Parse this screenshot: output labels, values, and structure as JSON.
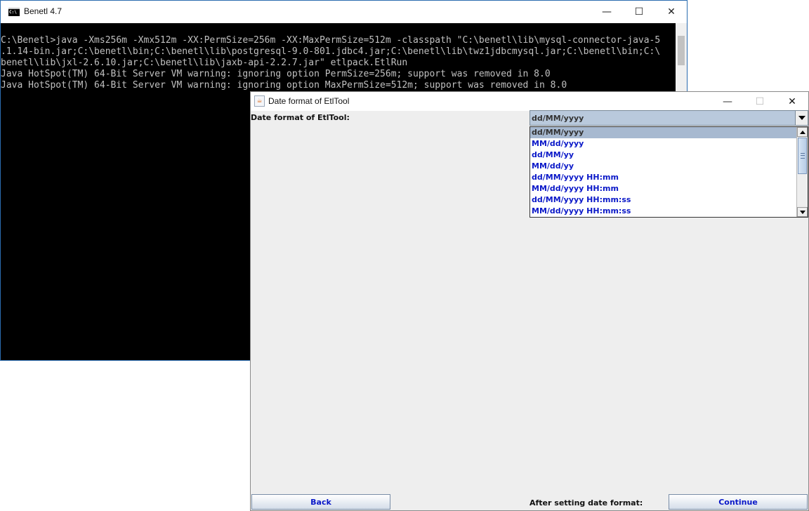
{
  "console": {
    "title": "Benetl 4.7",
    "lines": [
      "C:\\Benetl>java -Xms256m -Xmx512m -XX:PermSize=256m -XX:MaxPermSize=512m -classpath \"C:\\benetl\\lib\\mysql-connector-java-5",
      ".1.14-bin.jar;C:\\benetl\\bin;C:\\benetl\\lib\\postgresql-9.0-801.jdbc4.jar;C:\\benetl\\lib\\twz1jdbcmysql.jar;C:\\benetl\\bin;C:\\",
      "benetl\\lib\\jxl-2.6.10.jar;C:\\benetl\\lib\\jaxb-api-2.2.7.jar\" etlpack.EtlRun",
      "Java HotSpot(TM) 64-Bit Server VM warning: ignoring option PermSize=256m; support was removed in 8.0",
      "Java HotSpot(TM) 64-Bit Server VM warning: ignoring option MaxPermSize=512m; support was removed in 8.0"
    ],
    "controls": {
      "minimize": "—",
      "maximize": "☐",
      "close": "✕"
    }
  },
  "dialog": {
    "title": "Date format of EtlTool",
    "field_label": "Date format of EtlTool:",
    "combo": {
      "selected": "dd/MM/yyyy",
      "options": [
        "dd/MM/yyyy",
        "MM/dd/yyyy",
        "dd/MM/yy",
        "MM/dd/yy",
        "dd/MM/yyyy HH:mm",
        "MM/dd/yyyy HH:mm",
        "dd/MM/yyyy HH:mm:ss",
        "MM/dd/yyyy HH:mm:ss"
      ]
    },
    "footer_label": "After setting date format:",
    "back_label": "Back",
    "continue_label": "Continue",
    "controls": {
      "minimize": "—",
      "maximize": "☐",
      "close": "✕"
    },
    "java_icon_glyph": "☕"
  },
  "colors": {
    "link_blue": "#0a18c8",
    "selection": "#a7b9d0",
    "console_bg": "#000000",
    "console_fg": "#c0c0c0"
  }
}
